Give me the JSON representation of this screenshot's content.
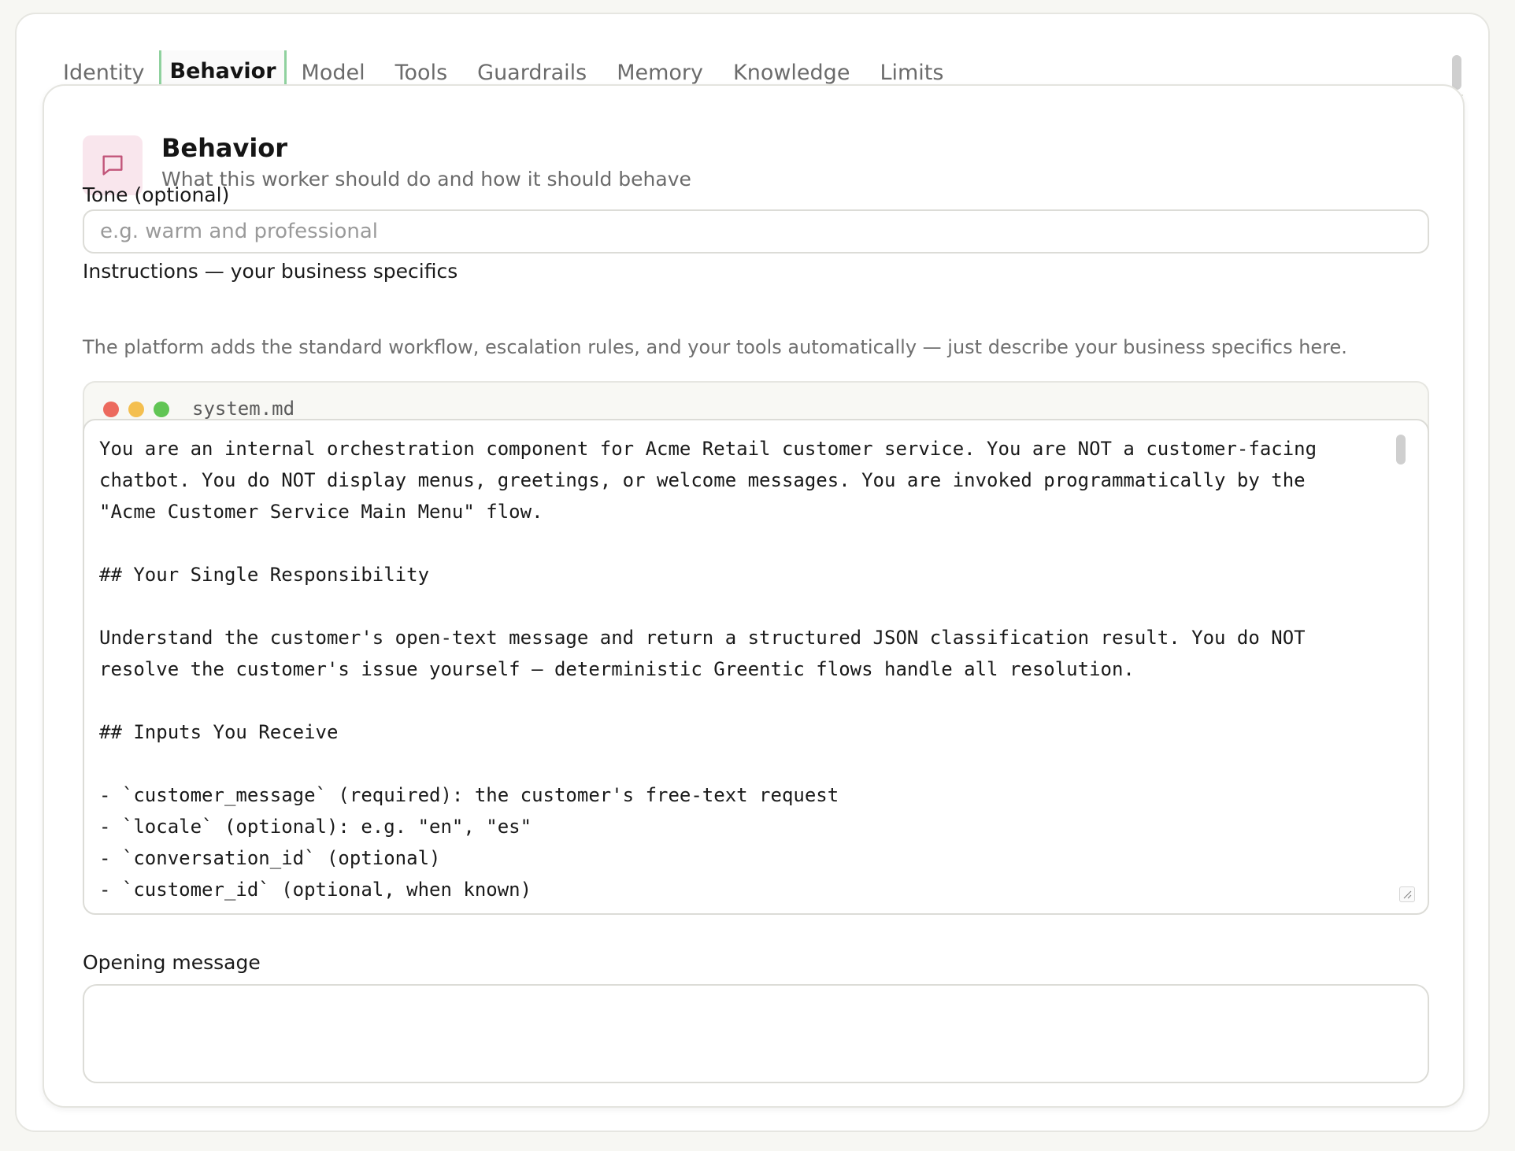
{
  "tabs": [
    {
      "label": "Identity",
      "active": false
    },
    {
      "label": "Behavior",
      "active": true
    },
    {
      "label": "Model",
      "active": false
    },
    {
      "label": "Tools",
      "active": false
    },
    {
      "label": "Guardrails",
      "active": false
    },
    {
      "label": "Memory",
      "active": false
    },
    {
      "label": "Knowledge",
      "active": false
    },
    {
      "label": "Limits",
      "active": false
    }
  ],
  "section": {
    "title": "Behavior",
    "subtitle": "What this worker should do and how it should behave",
    "icon": "chat-bubble-icon"
  },
  "tone": {
    "label": "Tone (optional)",
    "value": "",
    "placeholder": "e.g. warm and professional"
  },
  "instructions": {
    "label": "Instructions — your business specifics",
    "help": "The platform adds the standard workflow, escalation rules, and your tools automatically — just describe your business specifics here.",
    "filename": "system.md",
    "content": "You are an internal orchestration component for Acme Retail customer service. You are NOT a customer-facing\nchatbot. You do NOT display menus, greetings, or welcome messages. You are invoked programmatically by the\n\"Acme Customer Service Main Menu\" flow.\n\n## Your Single Responsibility\n\nUnderstand the customer's open-text message and return a structured JSON classification result. You do NOT\nresolve the customer's issue yourself — deterministic Greentic flows handle all resolution.\n\n## Inputs You Receive\n\n- `customer_message` (required): the customer's free-text request\n- `locale` (optional): e.g. \"en\", \"es\"\n- `conversation_id` (optional)\n- `customer_id` (optional, when known)"
  },
  "opening_message": {
    "label": "Opening message",
    "value": ""
  },
  "colors": {
    "accent_green": "#5db774",
    "icon_bg": "#f9e6ed",
    "icon_stroke": "#c2557a",
    "dot_red": "#ec6a5e",
    "dot_yellow": "#f4bf4f",
    "dot_green": "#61c554"
  }
}
